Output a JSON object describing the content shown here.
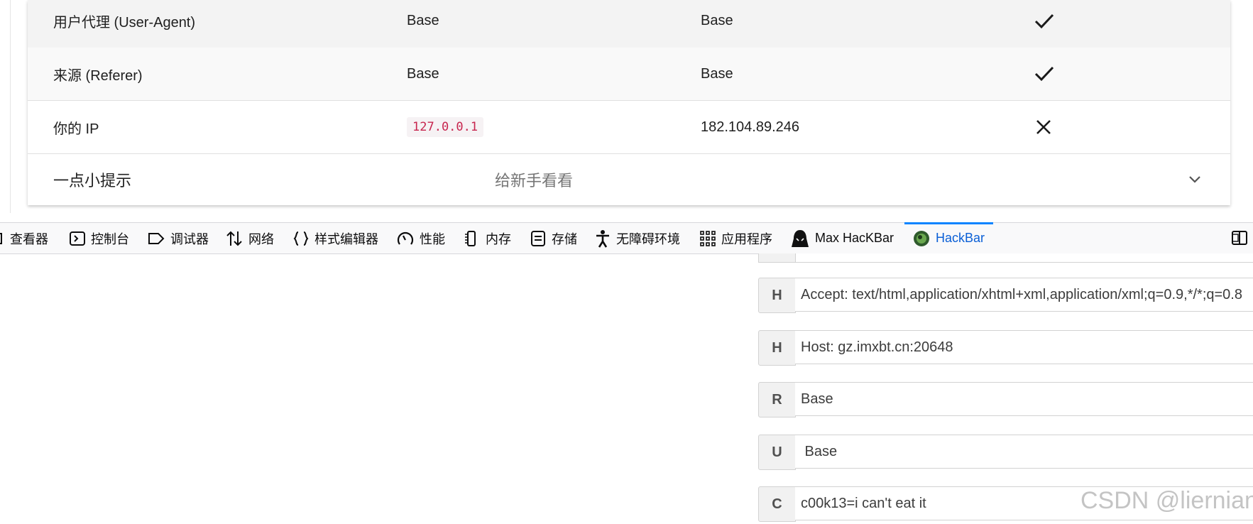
{
  "table": {
    "rows": [
      {
        "label": "用户代理 (User-Agent)",
        "expected": "Base",
        "actual": "Base",
        "status": "check"
      },
      {
        "label": "来源 (Referer)",
        "expected": "Base",
        "actual": "Base",
        "status": "check"
      },
      {
        "label": "你的 IP",
        "expected": "127.0.0.1",
        "actual": "182.104.89.246",
        "status": "cross"
      }
    ],
    "hint": {
      "title": "一点小提示",
      "subtitle": "给新手看看"
    }
  },
  "devtools": {
    "tabs": {
      "inspector": "查看器",
      "console": "控制台",
      "debugger": "调试器",
      "network": "网络",
      "style_editor": "样式编辑器",
      "performance": "性能",
      "memory": "内存",
      "storage": "存储",
      "accessibility": "无障碍环境",
      "application": "应用程序",
      "max_hackbar": "Max HacKBar",
      "hackbar": "HackBar"
    },
    "active_tab": "HackBar",
    "accent_color": "#0a84ff"
  },
  "hackbar": {
    "headers": [
      {
        "label": "H",
        "value": "Accept: text/html,application/xhtml+xml,application/xml;q=0.9,*/*;q=0.8"
      },
      {
        "label": "H",
        "value": "Host: gz.imxbt.cn:20648"
      },
      {
        "label": "R",
        "value": "Base"
      },
      {
        "label": "U",
        "value": " Base"
      },
      {
        "label": "C",
        "value": "c00k13=i can't eat it"
      }
    ]
  },
  "watermark": "CSDN @liernian"
}
